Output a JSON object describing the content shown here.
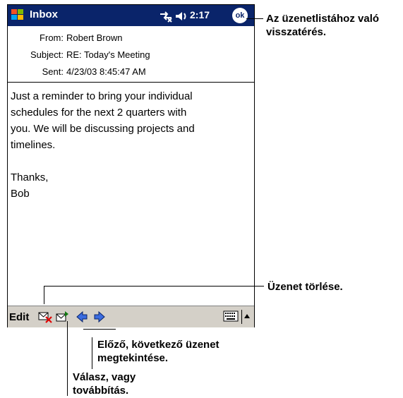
{
  "titlebar": {
    "title": "Inbox",
    "time": "2:17",
    "ok_label": "ok"
  },
  "message": {
    "from_label": "From:",
    "from_value": "Robert Brown",
    "subject_label": "Subject:",
    "subject_value": "RE: Today's Meeting",
    "sent_label": "Sent:",
    "sent_value": "4/23/03 8:45:47 AM",
    "body_lines": [
      "Just a reminder to bring your individual",
      "schedules for the next 2 quarters with",
      "you. We will be discussing projects and",
      "timelines.",
      "Thanks,",
      "Bob"
    ]
  },
  "toolbar": {
    "edit_label": "Edit"
  },
  "callouts": {
    "ok": "Az üzenetlistához való visszatérés.",
    "delete": "Üzenet törlése.",
    "prevnext": "Előző, következő üzenet megtekintése.",
    "reply": "Válasz, vagy továbbítás."
  },
  "colors": {
    "titlebar": "#0a246a",
    "toolbar": "#d4d0c8"
  }
}
